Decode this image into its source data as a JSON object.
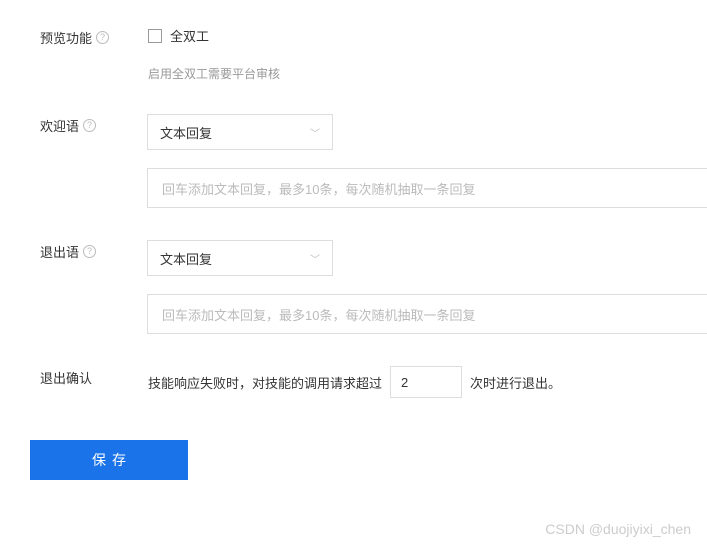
{
  "preview": {
    "label": "预览功能",
    "checkbox_label": "全双工",
    "hint": "启用全双工需要平台审核"
  },
  "welcome": {
    "label": "欢迎语",
    "select_value": "文本回复",
    "input_placeholder": "回车添加文本回复，最多10条，每次随机抽取一条回复"
  },
  "exit": {
    "label": "退出语",
    "select_value": "文本回复",
    "input_placeholder": "回车添加文本回复，最多10条，每次随机抽取一条回复"
  },
  "exit_confirm": {
    "label": "退出确认",
    "text_before": "技能响应失败时，对技能的调用请求超过",
    "value": "2",
    "text_after": "次时进行退出。"
  },
  "save_label": "保存",
  "help_glyph": "?",
  "watermark": "CSDN @duojiyixi_chen"
}
